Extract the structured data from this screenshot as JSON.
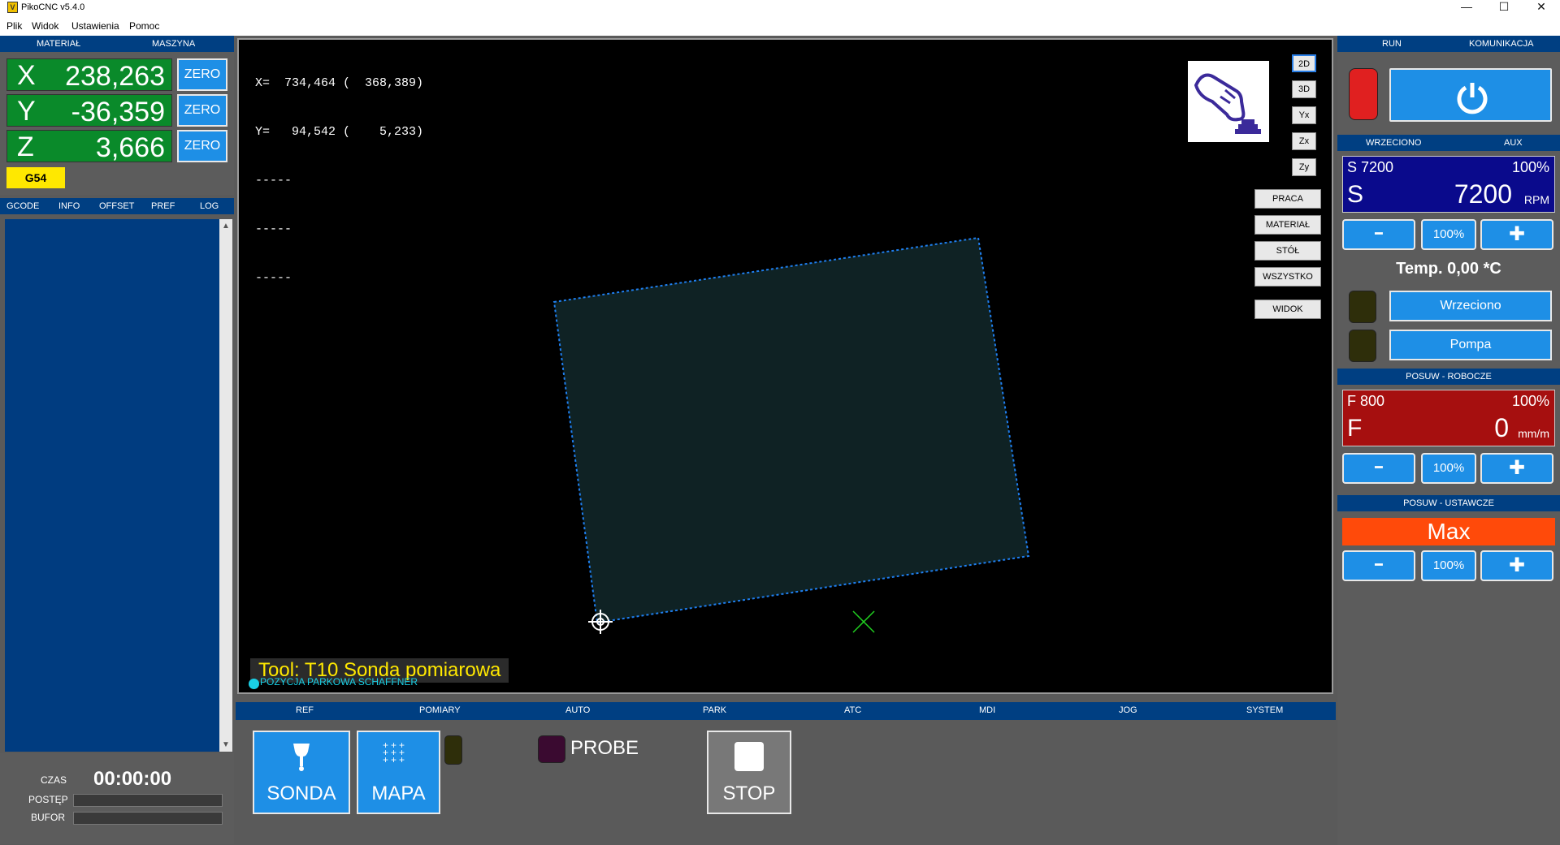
{
  "window": {
    "title": "PikoCNC v5.4.0",
    "minimize": "—",
    "maximize": "☐",
    "close": "✕"
  },
  "menu": [
    "Plik",
    "Widok",
    "Ustawienia",
    "Pomoc"
  ],
  "coords_header": {
    "material": "MATERIAŁ",
    "machine": "MASZYNA"
  },
  "axes": [
    {
      "label": "X",
      "value": "238,263",
      "zero": "ZERO"
    },
    {
      "label": "Y",
      "value": "-36,359",
      "zero": "ZERO"
    },
    {
      "label": "Z",
      "value": "3,666",
      "zero": "ZERO"
    }
  ],
  "work_offset": "G54",
  "left_tabs": [
    "GCODE",
    "INFO",
    "OFFSET",
    "PREF",
    "LOG"
  ],
  "status": {
    "time_label": "CZAS",
    "time_value": "00:00:00",
    "progress_label": "POSTĘP",
    "buffer_label": "BUFOR",
    "progress": 0,
    "buffer": 0
  },
  "viewport": {
    "coord_lines": [
      "X=  734,464 (  368,389)",
      "Y=   94,542 (    5,233)",
      "-----",
      "-----",
      "-----"
    ],
    "view_buttons": [
      "2D",
      "3D",
      "Yx",
      "Zx",
      "Zy"
    ],
    "active_view": "2D",
    "work_buttons": [
      "PRACA",
      "MATERIAŁ",
      "STÓŁ",
      "WSZYSTKO"
    ],
    "widok_button": "WIDOK",
    "tool_label": "Tool: T10 Sonda pomiarowa",
    "park_label": "POZYCJA PARKOWA SCHAFFNER",
    "hand_icon": "hand-press-button-icon"
  },
  "bottom_tabs": [
    "REF",
    "POMIARY",
    "AUTO",
    "PARK",
    "ATC",
    "MDI",
    "JOG",
    "SYSTEM"
  ],
  "bottom": {
    "sonda": "SONDA",
    "mapa": "MAPA",
    "probe": "PROBE",
    "stop": "STOP"
  },
  "right": {
    "run_tab": "RUN",
    "comm_tab": "KOMUNIKACJA",
    "spindle_tab": "WRZECIONO",
    "aux_tab": "AUX",
    "spindle": {
      "set": "S 7200",
      "pct": "100%",
      "letter": "S",
      "value": "7200",
      "unit": "RPM",
      "reset": "100%"
    },
    "temp": "Temp. 0,00 *C",
    "wrzeciono_btn": "Wrzeciono",
    "pompa_btn": "Pompa",
    "feed_header": "POSUW - ROBOCZE",
    "feed": {
      "set": "F 800",
      "pct": "100%",
      "letter": "F",
      "value": "0",
      "unit": "mm/m",
      "reset": "100%"
    },
    "rapid_header": "POSUW - USTAWCZE",
    "rapid": {
      "value": "Max",
      "reset": "100%"
    }
  },
  "colors": {
    "accent": "#1e8fe6",
    "axis_green": "#0a8a2a",
    "header_blue": "#003f82",
    "spindle_bg": "#0a0a8c",
    "feed_bg": "#a60f0f",
    "rapid_bg": "#ff4a0a"
  }
}
